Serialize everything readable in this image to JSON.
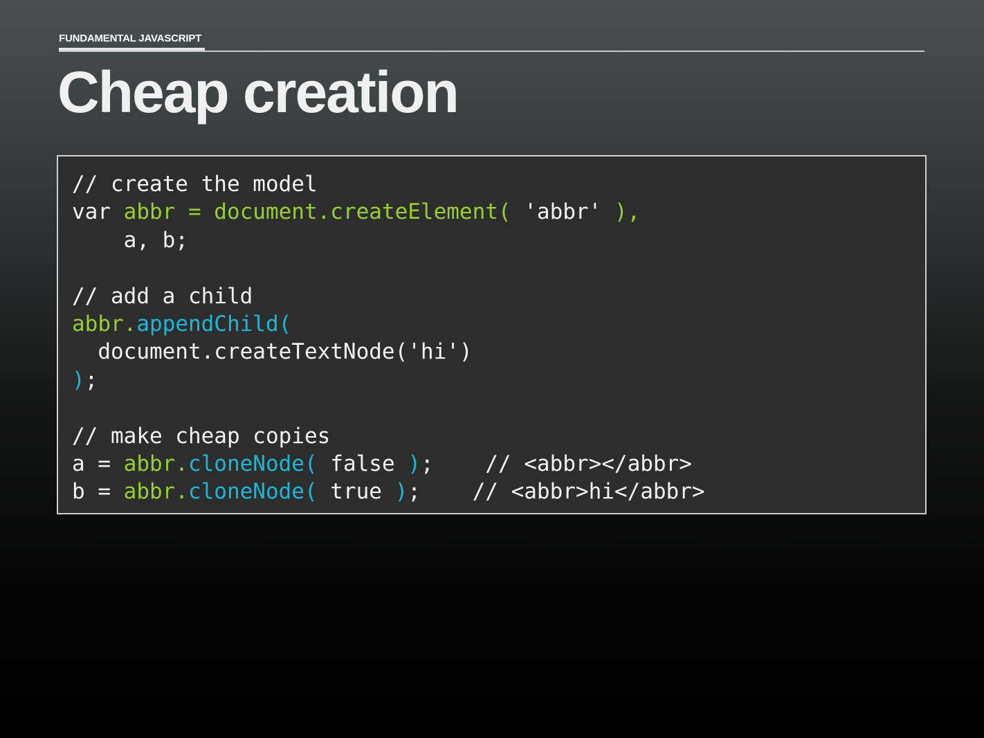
{
  "section_label": "FUNDAMENTAL JAVASCRIPT",
  "title": "Cheap creation",
  "code": {
    "line1": "// create the model",
    "line2_var": "var ",
    "line2_decl": "abbr = document.createElement(",
    "line2_arg": " 'abbr' ",
    "line2_close": "),",
    "line3": "    a, b;",
    "line5": "// add a child",
    "line6_obj": "abbr.",
    "line6_method": "appendChild(",
    "line7": "  document.createTextNode('hi')",
    "line8_close": ")",
    "line8_semi": ";",
    "line10": "// make cheap copies",
    "line11_lhs": "a = ",
    "line11_obj": "abbr.",
    "line11_method": "cloneNode(",
    "line11_arg": " false ",
    "line11_close": ")",
    "line11_rest": ";    // <abbr></abbr>",
    "line12_lhs": "b = ",
    "line12_obj": "abbr.",
    "line12_method": "cloneNode(",
    "line12_arg": " true ",
    "line12_close": ")",
    "line12_rest": ";    // <abbr>hi</abbr>"
  },
  "colors": {
    "identifier": "#9acd32",
    "method": "#1ab8d6",
    "text": "#f2f2f2"
  }
}
